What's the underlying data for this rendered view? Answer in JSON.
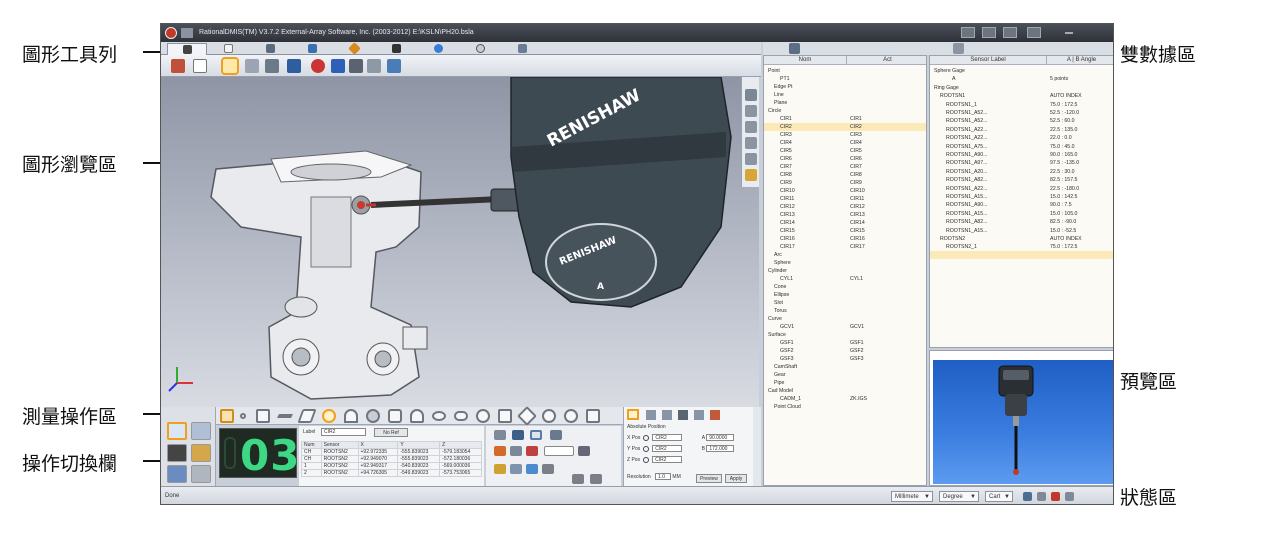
{
  "callouts": {
    "graphics_toolbar": "圖形工具列",
    "graphics_view": "圖形瀏覽區",
    "measure_area": "測量操作區",
    "switch_bar": "操作切換欄",
    "dual_data": "雙數據區",
    "preview": "預覽區",
    "status": "狀態區"
  },
  "window": {
    "title": "RationalDMIS(TM) V3.7.2   External-Array Software, Inc. (2003-2012)   E:\\KSLN\\PH20.bsla"
  },
  "probe": {
    "brand": "RENISHAW",
    "axis_label": "A"
  },
  "counter": {
    "value": "03"
  },
  "feature_form": {
    "label_caption": "Label",
    "label_value": "CIR2",
    "no_ref_button": "No Ref",
    "columns": [
      "Num",
      "Sensor",
      "X",
      "Y",
      "Z"
    ],
    "rows": [
      [
        "CH",
        "ROOTSN2",
        "+92.972335",
        "-555.839023",
        "-579.183054"
      ],
      [
        "CH",
        "ROOTSN2",
        "+92.949070",
        "-555.839023",
        "-572.180036"
      ],
      [
        "1",
        "ROOTSN2",
        "+92.949317",
        "-540.839023",
        "-569.000036"
      ],
      [
        "2",
        "ROOTSN2",
        "+94.726305",
        "-549.839023",
        "-573.753065"
      ]
    ]
  },
  "position_panel": {
    "header": "Absolute Position",
    "x_label": "X Pos",
    "y_label": "Y Pos",
    "z_label": "Z Pos",
    "x_value": "CIR2",
    "y_value": "CIR2",
    "z_value": "CIR2",
    "a_label": "A",
    "a_value": "90.0000",
    "b_label": "B",
    "b_value": "172.000",
    "resolution_label": "Resolution",
    "resolution_value": "1.0",
    "resolution_unit": "MM",
    "preview_button": "Preview",
    "apply_button": "Apply"
  },
  "nominal_tree": {
    "col_nom": "Nom",
    "col_act": "Act",
    "rows": [
      {
        "nom": "Point",
        "act": "",
        "indent": 0
      },
      {
        "nom": "PT1",
        "act": "",
        "indent": 2
      },
      {
        "nom": "Edge Pt",
        "act": "",
        "indent": 1
      },
      {
        "nom": "Line",
        "act": "",
        "indent": 1
      },
      {
        "nom": "Plane",
        "act": "",
        "indent": 1
      },
      {
        "nom": "Circle",
        "act": "",
        "indent": 0
      },
      {
        "nom": "CIR1",
        "act": "CIR1",
        "indent": 2
      },
      {
        "nom": "CIR2",
        "act": "CIR2",
        "indent": 2
      },
      {
        "nom": "CIR3",
        "act": "CIR3",
        "indent": 2
      },
      {
        "nom": "CIR4",
        "act": "CIR4",
        "indent": 2
      },
      {
        "nom": "CIR5",
        "act": "CIR5",
        "indent": 2
      },
      {
        "nom": "CIR6",
        "act": "CIR6",
        "indent": 2
      },
      {
        "nom": "CIR7",
        "act": "CIR7",
        "indent": 2
      },
      {
        "nom": "CIR8",
        "act": "CIR8",
        "indent": 2
      },
      {
        "nom": "CIR9",
        "act": "CIR9",
        "indent": 2
      },
      {
        "nom": "CIR10",
        "act": "CIR10",
        "indent": 2
      },
      {
        "nom": "CIR11",
        "act": "CIR11",
        "indent": 2
      },
      {
        "nom": "CIR12",
        "act": "CIR12",
        "indent": 2
      },
      {
        "nom": "CIR13",
        "act": "CIR13",
        "indent": 2
      },
      {
        "nom": "CIR14",
        "act": "CIR14",
        "indent": 2
      },
      {
        "nom": "CIR15",
        "act": "CIR15",
        "indent": 2
      },
      {
        "nom": "CIR16",
        "act": "CIR16",
        "indent": 2
      },
      {
        "nom": "CIR17",
        "act": "CIR17",
        "indent": 2
      },
      {
        "nom": "Arc",
        "act": "",
        "indent": 1
      },
      {
        "nom": "Sphere",
        "act": "",
        "indent": 1
      },
      {
        "nom": "Cylinder",
        "act": "",
        "indent": 0
      },
      {
        "nom": "CYL1",
        "act": "CYL1",
        "indent": 2
      },
      {
        "nom": "Cone",
        "act": "",
        "indent": 1
      },
      {
        "nom": "Ellipse",
        "act": "",
        "indent": 1
      },
      {
        "nom": "Slot",
        "act": "",
        "indent": 1
      },
      {
        "nom": "Torus",
        "act": "",
        "indent": 1
      },
      {
        "nom": "Curve",
        "act": "",
        "indent": 0
      },
      {
        "nom": "GCV1",
        "act": "GCV1",
        "indent": 2
      },
      {
        "nom": "Surface",
        "act": "",
        "indent": 0
      },
      {
        "nom": "GSF1",
        "act": "GSF1",
        "indent": 2
      },
      {
        "nom": "GSF2",
        "act": "GSF2",
        "indent": 2
      },
      {
        "nom": "GSF3",
        "act": "GSF3",
        "indent": 2
      },
      {
        "nom": "CamShaft",
        "act": "",
        "indent": 1
      },
      {
        "nom": "Gear",
        "act": "",
        "indent": 1
      },
      {
        "nom": "Pipe",
        "act": "",
        "indent": 1
      },
      {
        "nom": "Cad Model",
        "act": "",
        "indent": 0
      },
      {
        "nom": "CADM_1",
        "act": "ZK.IGS",
        "indent": 2
      },
      {
        "nom": "Point Cloud",
        "act": "",
        "indent": 1
      }
    ]
  },
  "sensor_tree": {
    "col_label": "Sensor Label",
    "col_angle": "A | B Angle",
    "rows": [
      {
        "label": "Sphere Gage",
        "value": "",
        "indent": 0
      },
      {
        "label": "A",
        "value": "5 points",
        "indent": 3
      },
      {
        "label": "Ring Gage",
        "value": "",
        "indent": 0
      },
      {
        "label": "ROOTSN1",
        "value": "AUTO INDEX",
        "indent": 1
      },
      {
        "label": "ROOTSN1_1",
        "value": "75.0 : 172.5",
        "indent": 2
      },
      {
        "label": "ROOTSN1_A52...",
        "value": "52.5 : -120.0",
        "indent": 2
      },
      {
        "label": "ROOTSN1_A52...",
        "value": "52.5 : 60.0",
        "indent": 2
      },
      {
        "label": "ROOTSN1_A22...",
        "value": "22.5 : 135.0",
        "indent": 2
      },
      {
        "label": "ROOTSN1_A22...",
        "value": "22.0 : 0.0",
        "indent": 2
      },
      {
        "label": "ROOTSN1_A75...",
        "value": "75.0 : 45.0",
        "indent": 2
      },
      {
        "label": "ROOTSN1_A90...",
        "value": "90.0 : 165.0",
        "indent": 2
      },
      {
        "label": "ROOTSN1_A97...",
        "value": "97.5 : -135.0",
        "indent": 2
      },
      {
        "label": "ROOTSN1_A20...",
        "value": "22.5 : 30.0",
        "indent": 2
      },
      {
        "label": "ROOTSN1_A82...",
        "value": "82.5 : 157.5",
        "indent": 2
      },
      {
        "label": "ROOTSN1_A22...",
        "value": "22.5 : -180.0",
        "indent": 2
      },
      {
        "label": "ROOTSN1_A15...",
        "value": "15.0 : 142.5",
        "indent": 2
      },
      {
        "label": "ROOTSN1_A90...",
        "value": "90.0 : 7.5",
        "indent": 2
      },
      {
        "label": "ROOTSN1_A15...",
        "value": "15.0 : 105.0",
        "indent": 2
      },
      {
        "label": "ROOTSN1_A82...",
        "value": "82.5 : -90.0",
        "indent": 2
      },
      {
        "label": "ROOTSN1_A15...",
        "value": "15.0 : -52.5",
        "indent": 2
      },
      {
        "label": "ROOTSN2",
        "value": "AUTO INDEX",
        "indent": 1
      },
      {
        "label": "ROOTSN2_1",
        "value": "75.0 : 172.5",
        "indent": 2
      }
    ]
  },
  "status": {
    "text": "Done",
    "unit": "Millimete",
    "angle": "Degree",
    "coord": "Cart"
  },
  "colors": {
    "accent": "#f0a020",
    "counter": "#3dd884",
    "probe_body": "#3e4a52",
    "preview_bg": "#2f72d8"
  }
}
